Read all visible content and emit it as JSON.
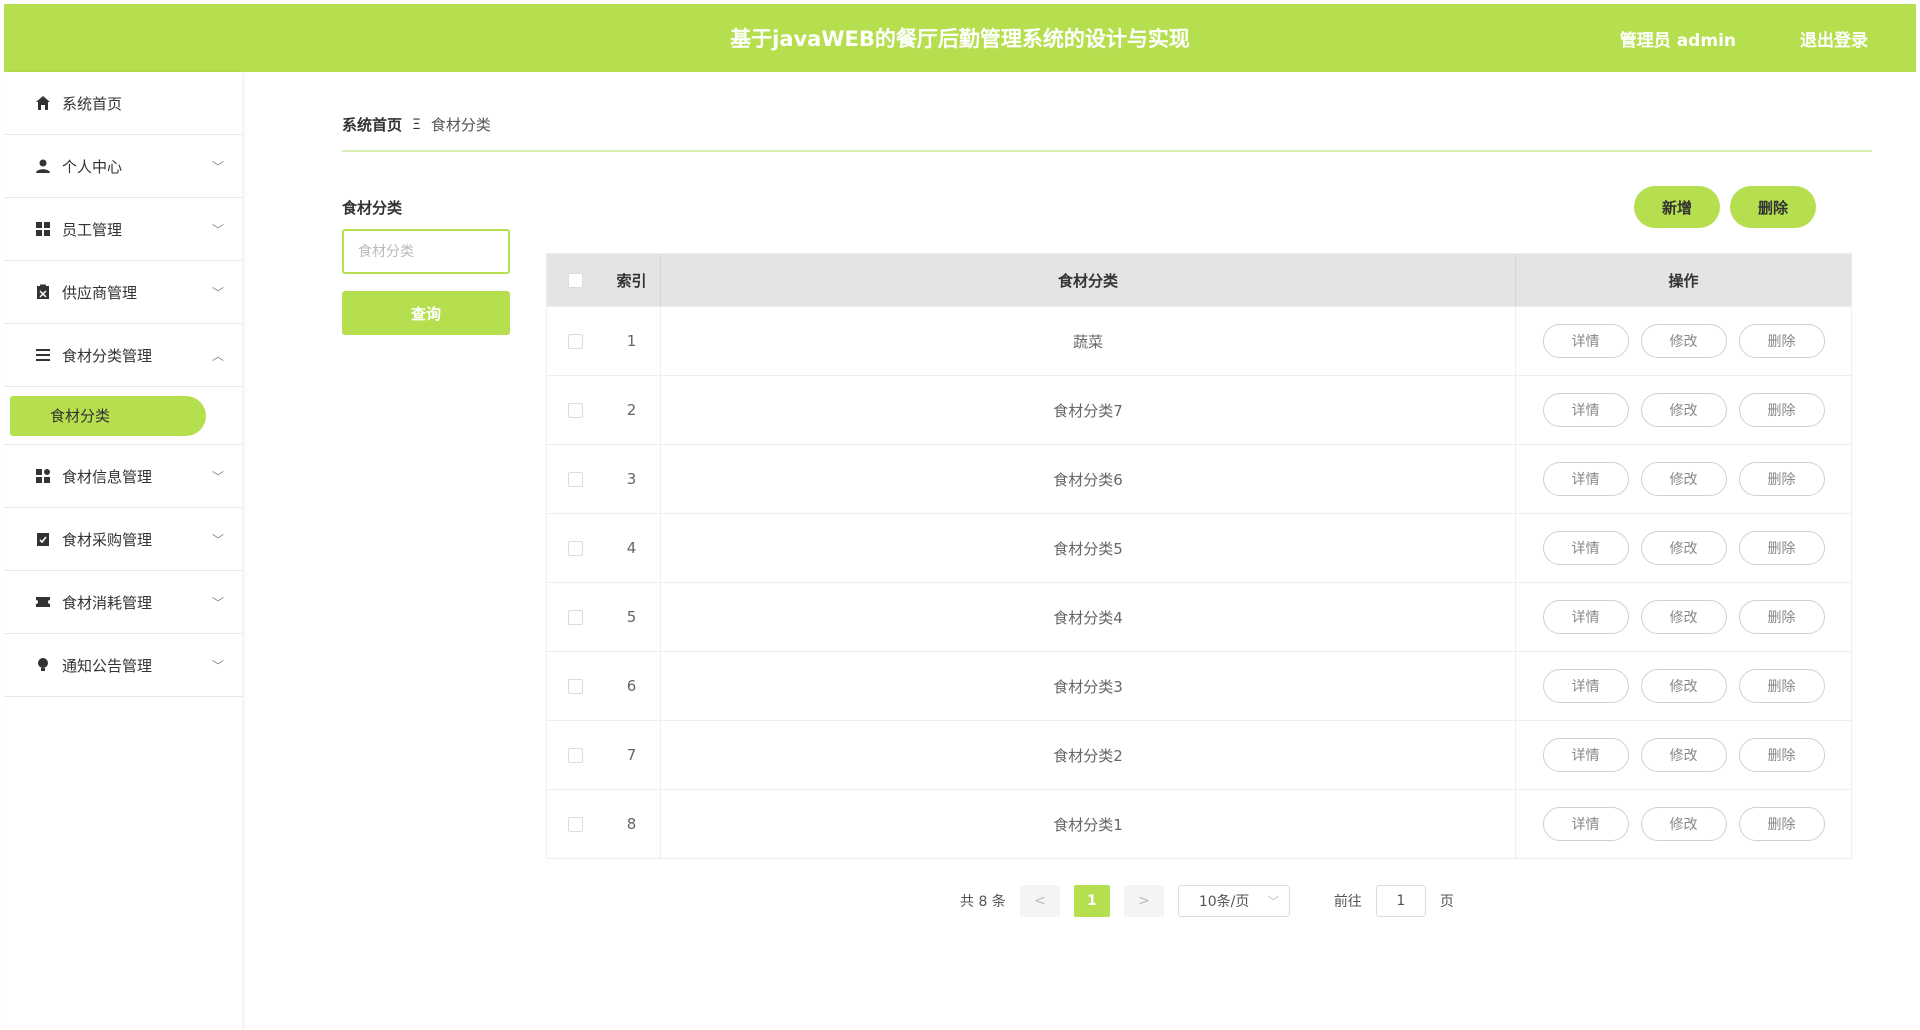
{
  "header": {
    "title": "基于javaWEB的餐厅后勤管理系统的设计与实现",
    "user": "管理员 admin",
    "logout": "退出登录"
  },
  "sidebar": {
    "items": [
      {
        "label": "系统首页",
        "icon": "home-icon",
        "arrow": ""
      },
      {
        "label": "个人中心",
        "icon": "user-icon",
        "arrow": "﹀"
      },
      {
        "label": "员工管理",
        "icon": "grid-icon",
        "arrow": "﹀"
      },
      {
        "label": "供应商管理",
        "icon": "clipboard-icon",
        "arrow": "﹀"
      },
      {
        "label": "食材分类管理",
        "icon": "list-icon",
        "arrow": "︿"
      },
      {
        "label": "食材信息管理",
        "icon": "apps-icon",
        "arrow": "﹀"
      },
      {
        "label": "食材采购管理",
        "icon": "checklist-icon",
        "arrow": "﹀"
      },
      {
        "label": "食材消耗管理",
        "icon": "ticket-icon",
        "arrow": "﹀"
      },
      {
        "label": "通知公告管理",
        "icon": "bulb-icon",
        "arrow": "﹀"
      }
    ],
    "submenu_active": "食材分类"
  },
  "breadcrumb": {
    "home": "系统首页",
    "sep": "Ξ",
    "current": "食材分类"
  },
  "search": {
    "label": "食材分类",
    "placeholder": "食材分类",
    "button": "查询"
  },
  "actions": {
    "add": "新增",
    "delete": "删除"
  },
  "table": {
    "headers": {
      "index": "索引",
      "name": "食材分类",
      "ops": "操作"
    },
    "rows": [
      {
        "index": "1",
        "name": "蔬菜"
      },
      {
        "index": "2",
        "name": "食材分类7"
      },
      {
        "index": "3",
        "name": "食材分类6"
      },
      {
        "index": "4",
        "name": "食材分类5"
      },
      {
        "index": "5",
        "name": "食材分类4"
      },
      {
        "index": "6",
        "name": "食材分类3"
      },
      {
        "index": "7",
        "name": "食材分类2"
      },
      {
        "index": "8",
        "name": "食材分类1"
      }
    ],
    "op_labels": {
      "detail": "详情",
      "edit": "修改",
      "delete": "删除"
    }
  },
  "pager": {
    "total": "共 8 条",
    "prev": "<",
    "page": "1",
    "next": ">",
    "size": "10条/页",
    "goto": "前往",
    "goto_value": "1",
    "page_suffix": "页"
  },
  "colors": {
    "accent": "#b5df4e"
  }
}
